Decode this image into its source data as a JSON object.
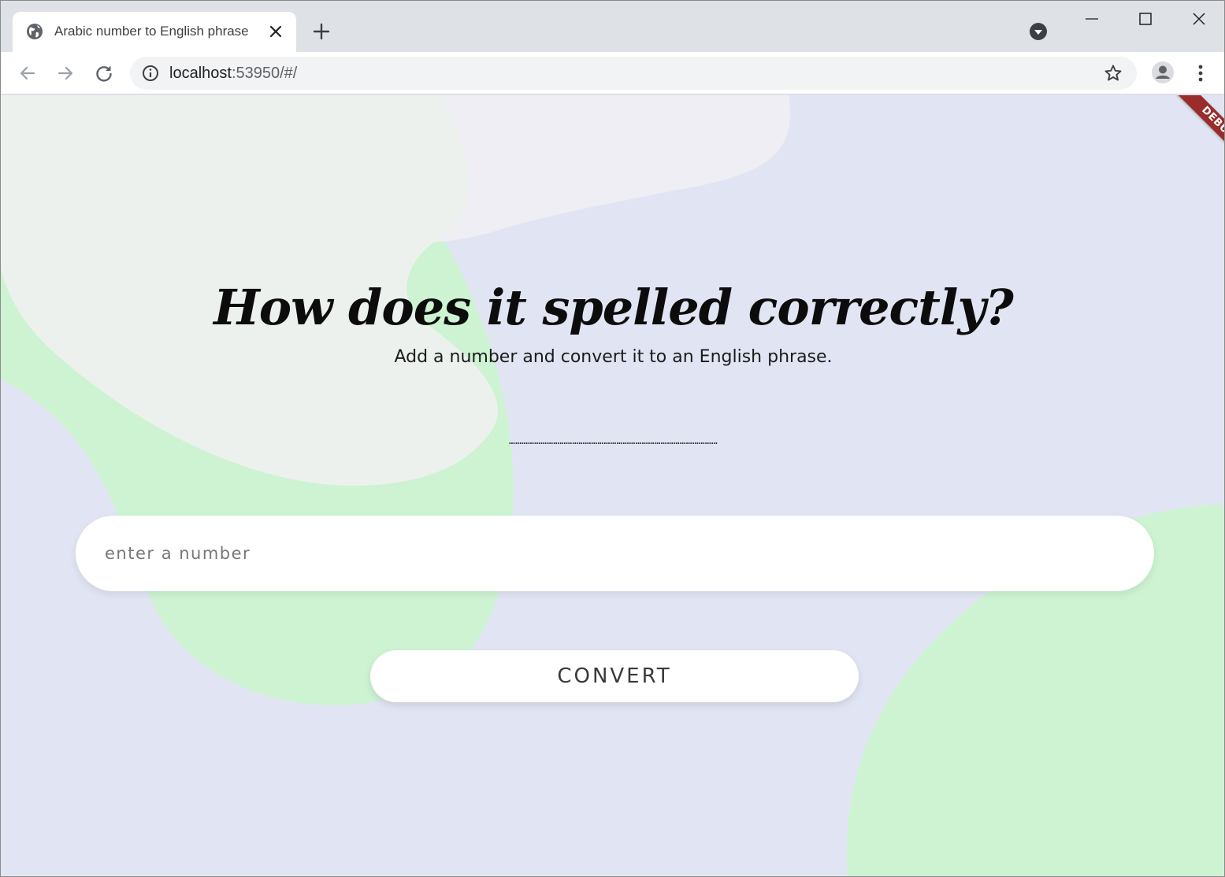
{
  "browser": {
    "tab": {
      "title": "Arabic number to English phrase",
      "favicon": "globe-icon",
      "close_icon": "close-icon"
    },
    "new_tab_icon": "plus-icon",
    "tab_search_icon": "chevron-down-circle-icon",
    "window_controls": [
      "minimize-icon",
      "maximize-icon",
      "close-icon"
    ],
    "address": {
      "host": "localhost",
      "rest": ":53950/#/",
      "site_info_icon": "info-icon"
    },
    "nav_icons": [
      "arrow-left-icon",
      "arrow-right-icon",
      "reload-icon"
    ],
    "bookmark_icon": "star-icon",
    "profile_icon": "person-icon",
    "menu_icon": "kebab-menu-icon"
  },
  "app": {
    "debug_banner": "DEBUG",
    "headline": "How does it spelled correctly?",
    "subtitle": "Add a number and convert it to an English phrase.",
    "result_placeholder": "………………………………………………………………………………………",
    "input": {
      "value": "",
      "placeholder": "enter a number"
    },
    "convert_label": "CONVERT"
  },
  "colors": {
    "background": "#e1e5f3",
    "blob_green": "#cdf3d2",
    "blob_light": "#edf1ee",
    "blob_pale": "#eeeef4",
    "debug_red": "#9b2c2c",
    "card_white": "#ffffff"
  }
}
